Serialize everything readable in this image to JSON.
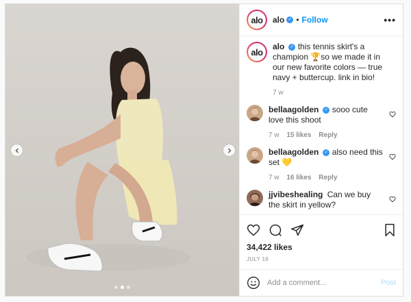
{
  "header": {
    "username": "alo",
    "avatar_text": "alo",
    "follow_label": "Follow",
    "separator": "•",
    "more_label": "•••"
  },
  "caption": {
    "username": "alo",
    "text": "this tennis skirt's a champion 🏆so we made it in our new favorite colors — true navy + buttercup. link in bio!",
    "time": "7 w"
  },
  "comments": [
    {
      "username": "bellaagolden",
      "verified": true,
      "text": "sooo cute love this shoot",
      "time": "7 w",
      "likes": "15 likes",
      "reply": "Reply"
    },
    {
      "username": "bellaagolden",
      "verified": true,
      "text": "also need this set 💛",
      "time": "7 w",
      "likes": "16 likes",
      "reply": "Reply"
    },
    {
      "username": "jjvibeshealing",
      "verified": false,
      "text": "Can we buy the skirt in yellow?"
    }
  ],
  "engagement": {
    "likes": "34,422 likes",
    "date": "July 16"
  },
  "composer": {
    "placeholder": "Add a comment...",
    "post_label": "Post"
  },
  "carousel": {
    "slide_count": 3,
    "active_index": 1
  },
  "colors": {
    "link_blue": "#0095f6",
    "verified_blue": "#3897f0",
    "muted": "#8e8e8e"
  }
}
